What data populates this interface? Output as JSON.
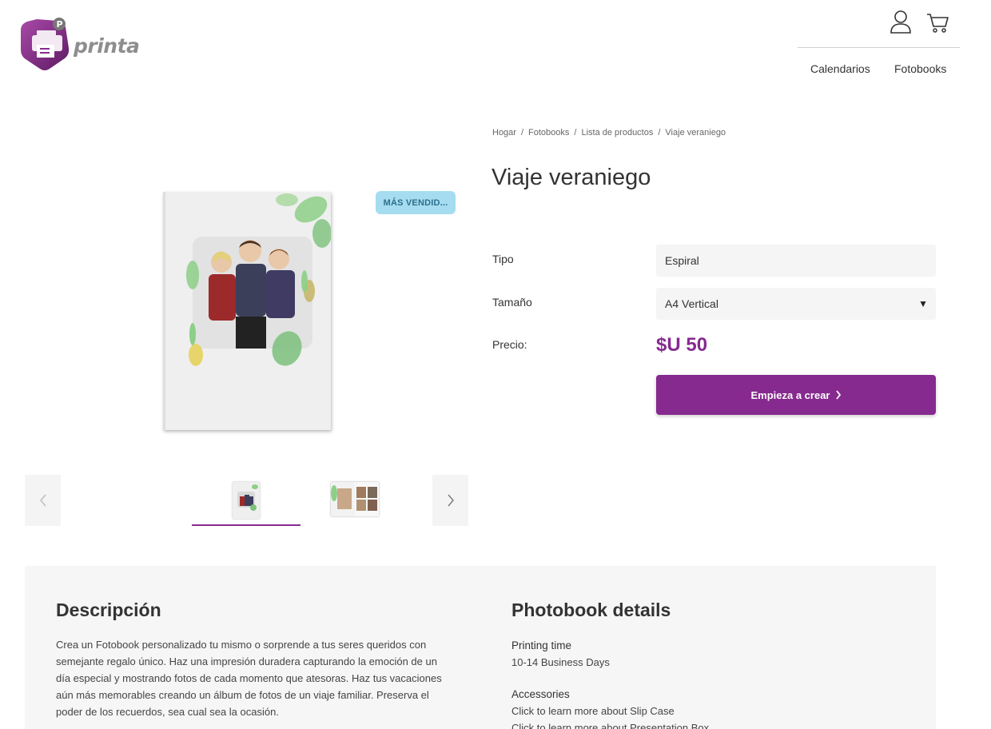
{
  "brand": {
    "name": "printa",
    "color": "#862a8f"
  },
  "nav": {
    "calendarios": "Calendarios",
    "fotobooks": "Fotobooks"
  },
  "icons": {
    "user": "user-icon",
    "cart": "cart-icon",
    "prev": "chevron-left-icon",
    "next": "chevron-right-icon",
    "cta": "chevron-right-icon"
  },
  "breadcrumb": [
    "Hogar",
    "Fotobooks",
    "Lista de productos",
    "Viaje veraniego"
  ],
  "product": {
    "title": "Viaje veraniego",
    "badge": "MÁS VENDID...",
    "tipo_label": "Tipo",
    "tipo_value": "Espiral",
    "tamano_label": "Tamaño",
    "tamano_value": "A4 Vertical",
    "precio_label": "Precio:",
    "precio_value": "$U 50",
    "cta": "Empieza a crear"
  },
  "description": {
    "heading": "Descripción",
    "text": "Crea un Fotobook personalizado tu mismo o sorprende a tus seres queridos con semejante regalo único. Haz una impresión duradera capturando la emoción de un día especial y mostrando fotos de cada momento que atesoras. Haz tus vacaciones aún más memorables creando un álbum de fotos de un viaje familiar. Preserva el poder de los recuerdos, sea cual sea la ocasión."
  },
  "details": {
    "heading": "Photobook details",
    "printing_time_label": "Printing time",
    "printing_time_value": "10-14 Business Days",
    "accessories_label": "Accessories",
    "accessory_1": "Click to learn more about Slip Case",
    "accessory_2": "Click to learn more about Presentation Box"
  }
}
